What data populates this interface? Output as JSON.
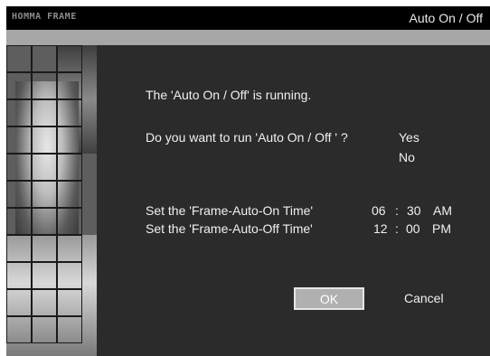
{
  "titlebar": {
    "brand": "HOMMA FRAME",
    "title": "Auto On / Off"
  },
  "dialog": {
    "status_message": "The 'Auto On / Off' is running.",
    "question": "Do you want to run 'Auto On / Off ' ?",
    "options": [
      "Yes",
      "No"
    ],
    "on_time_label": "Set the 'Frame-Auto-On Time'",
    "off_time_label": "Set the 'Frame-Auto-Off Time'",
    "on_time": {
      "hour": "06",
      "sep": ":",
      "minute": "30",
      "period": "AM"
    },
    "off_time": {
      "hour": "12",
      "sep": ":",
      "minute": "00",
      "period": "PM"
    },
    "ok_label": "OK",
    "cancel_label": "Cancel"
  }
}
